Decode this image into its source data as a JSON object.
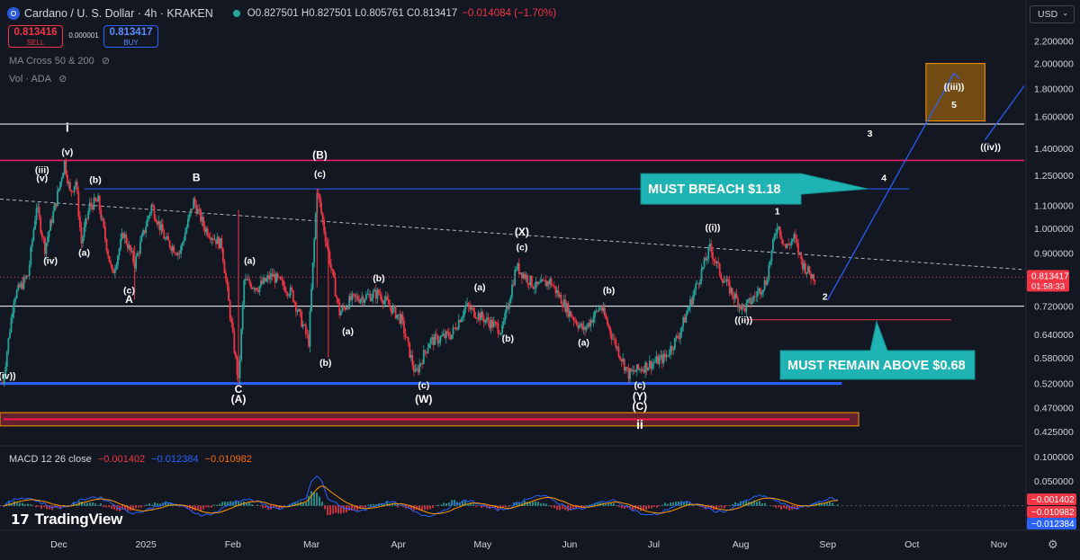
{
  "header": {
    "title": "Cardano / U. S. Dollar · 4h · KRAKEN",
    "ohlc": "O0.827501 H0.827501 L0.805761 C0.813417",
    "change": "−0.014084 (−1.70%)"
  },
  "trade": {
    "sell_price": "0.813416",
    "sell_label": "SELL",
    "spread": "0.000001",
    "buy_price": "0.813417",
    "buy_label": "BUY"
  },
  "indicators": {
    "ma": "MA Cross 50 & 200",
    "vol": "Vol · ADA"
  },
  "currency": "USD",
  "macd": {
    "label": "MACD 12 26 close",
    "macd": "−0.001402",
    "signal": "−0.012384",
    "hist": "−0.010982"
  },
  "brand": "TradingView",
  "colors": {
    "bg": "#131722",
    "up": "#26a69a",
    "down": "#f23645",
    "blue": "#2962ff",
    "magenta": "#e91e63",
    "teal": "#1fb3b3",
    "orange": "#ff9800"
  },
  "chart_data": {
    "type": "candlestick",
    "symbol": "ADAUSD",
    "interval": "4h",
    "exchange": "KRAKEN",
    "x_ticks": [
      "Dec",
      "2025",
      "Feb",
      "Mar",
      "Apr",
      "May",
      "Jun",
      "Jul",
      "Aug",
      "Sep",
      "Oct",
      "Nov"
    ],
    "y_ticks": [
      "2.200000",
      "2.000000",
      "1.800000",
      "1.600000",
      "1.400000",
      "1.250000",
      "1.100000",
      "1.000000",
      "0.900000",
      "0.720000",
      "0.640000",
      "0.580000",
      "0.520000",
      "0.470000",
      "0.425000"
    ],
    "y_scale": "log",
    "y_range": [
      0.4,
      2.35
    ],
    "x_range": [
      "2024-11-10",
      "2025-11-10"
    ],
    "price_path": [
      [
        "2024-11-11",
        0.52
      ],
      [
        "2024-11-15",
        0.75
      ],
      [
        "2024-11-20",
        0.82
      ],
      [
        "2024-11-23",
        1.1
      ],
      [
        "2024-11-26",
        0.92
      ],
      [
        "2024-11-30",
        1.12
      ],
      [
        "2024-12-03",
        1.32
      ],
      [
        "2024-12-05",
        1.16
      ],
      [
        "2024-12-07",
        1.22
      ],
      [
        "2024-12-09",
        0.94
      ],
      [
        "2024-12-12",
        1.1
      ],
      [
        "2024-12-15",
        1.12
      ],
      [
        "2024-12-20",
        0.82
      ],
      [
        "2024-12-24",
        0.98
      ],
      [
        "2024-12-28",
        0.86
      ],
      [
        "2025-01-03",
        1.1
      ],
      [
        "2025-01-08",
        0.95
      ],
      [
        "2025-01-13",
        0.9
      ],
      [
        "2025-01-18",
        1.12
      ],
      [
        "2025-01-22",
        1.0
      ],
      [
        "2025-01-28",
        0.93
      ],
      [
        "2025-02-03",
        0.52
      ],
      [
        "2025-02-05",
        0.8
      ],
      [
        "2025-02-10",
        0.78
      ],
      [
        "2025-02-15",
        0.82
      ],
      [
        "2025-02-22",
        0.76
      ],
      [
        "2025-02-28",
        0.62
      ],
      [
        "2025-03-03",
        1.18
      ],
      [
        "2025-03-07",
        0.9
      ],
      [
        "2025-03-11",
        0.7
      ],
      [
        "2025-03-15",
        0.74
      ],
      [
        "2025-03-25",
        0.76
      ],
      [
        "2025-04-02",
        0.68
      ],
      [
        "2025-04-07",
        0.54
      ],
      [
        "2025-04-12",
        0.62
      ],
      [
        "2025-04-20",
        0.64
      ],
      [
        "2025-04-25",
        0.72
      ],
      [
        "2025-05-02",
        0.68
      ],
      [
        "2025-05-08",
        0.65
      ],
      [
        "2025-05-13",
        0.85
      ],
      [
        "2025-05-20",
        0.78
      ],
      [
        "2025-05-25",
        0.8
      ],
      [
        "2025-06-01",
        0.7
      ],
      [
        "2025-06-06",
        0.65
      ],
      [
        "2025-06-12",
        0.72
      ],
      [
        "2025-06-17",
        0.62
      ],
      [
        "2025-06-22",
        0.54
      ],
      [
        "2025-06-28",
        0.56
      ],
      [
        "2025-07-05",
        0.58
      ],
      [
        "2025-07-10",
        0.64
      ],
      [
        "2025-07-16",
        0.78
      ],
      [
        "2025-07-21",
        0.92
      ],
      [
        "2025-07-25",
        0.82
      ],
      [
        "2025-07-29",
        0.76
      ],
      [
        "2025-08-02",
        0.71
      ],
      [
        "2025-08-06",
        0.75
      ],
      [
        "2025-08-10",
        0.8
      ],
      [
        "2025-08-14",
        1.02
      ],
      [
        "2025-08-17",
        0.92
      ],
      [
        "2025-08-20",
        0.96
      ],
      [
        "2025-08-23",
        0.86
      ],
      [
        "2025-08-26",
        0.82
      ],
      [
        "2025-08-28",
        0.8134
      ]
    ],
    "last_price": "0.813417",
    "countdown": "01:58:33",
    "levels": [
      {
        "price": 1.55,
        "color": "#ffffff",
        "from": "2024-11-10",
        "to": "2025-11-10"
      },
      {
        "price": 1.33,
        "color": "#e91e63",
        "from": "2024-11-10",
        "to": "2025-11-10"
      },
      {
        "price": 1.18,
        "color": "#2962ff",
        "from": "2024-12-10",
        "to": "2025-09-30"
      },
      {
        "price": 0.72,
        "color": "#ffffff",
        "from": "2024-11-10",
        "to": "2025-11-10"
      },
      {
        "price": 0.68,
        "color": "#f23645",
        "from": "2025-08-03",
        "to": "2025-10-15"
      },
      {
        "price": 0.52,
        "color": "#2962ff",
        "from": "2024-11-10",
        "to": "2025-09-06"
      }
    ],
    "trendline": {
      "from": [
        "2024-11-10",
        1.13
      ],
      "to": [
        "2025-11-10",
        0.84
      ],
      "style": "dashed"
    },
    "projection_box": {
      "x": [
        "2025-10-06",
        "2025-10-27"
      ],
      "y": [
        1.57,
        2.0
      ]
    },
    "bottom_zone": {
      "x": [
        "2024-11-10",
        "2025-09-12"
      ],
      "y": [
        0.435,
        0.46
      ]
    },
    "wave_labels": [
      {
        "text": "i",
        "x": "2024-12-04",
        "y": 1.5
      },
      {
        "text": "(v)",
        "x": "2024-12-04",
        "y": 1.36
      },
      {
        "text": "(iii)",
        "x": "2024-11-25",
        "y": 1.26
      },
      {
        "text": "(v)",
        "x": "2024-11-25",
        "y": 1.22
      },
      {
        "text": "(b)",
        "x": "2024-12-14",
        "y": 1.21
      },
      {
        "text": "B",
        "x": "2025-01-19",
        "y": 1.22
      },
      {
        "text": "(iv)",
        "x": "2024-11-28",
        "y": 0.86
      },
      {
        "text": "(a)",
        "x": "2024-12-10",
        "y": 0.89
      },
      {
        "text": "(c)",
        "x": "2024-12-26",
        "y": 0.76
      },
      {
        "text": "A",
        "x": "2024-12-26",
        "y": 0.73
      },
      {
        "text": "((iv))",
        "x": "2024-11-12",
        "y": 0.53
      },
      {
        "text": "C",
        "x": "2025-02-03",
        "y": 0.5
      },
      {
        "text": "(A)",
        "x": "2025-02-03",
        "y": 0.48
      },
      {
        "text": "(a)",
        "x": "2025-02-07",
        "y": 0.86
      },
      {
        "text": "(B)",
        "x": "2025-03-04",
        "y": 1.34
      },
      {
        "text": "(c)",
        "x": "2025-03-04",
        "y": 1.24
      },
      {
        "text": "(b)",
        "x": "2025-03-25",
        "y": 0.8
      },
      {
        "text": "(a)",
        "x": "2025-03-14",
        "y": 0.64
      },
      {
        "text": "(b)",
        "x": "2025-03-06",
        "y": 0.56
      },
      {
        "text": "(c)",
        "x": "2025-04-10",
        "y": 0.51
      },
      {
        "text": "(W)",
        "x": "2025-04-10",
        "y": 0.48
      },
      {
        "text": "(a)",
        "x": "2025-04-30",
        "y": 0.77
      },
      {
        "text": "(X)",
        "x": "2025-05-15",
        "y": 0.97
      },
      {
        "text": "(c)",
        "x": "2025-05-15",
        "y": 0.91
      },
      {
        "text": "(b)",
        "x": "2025-05-10",
        "y": 0.62
      },
      {
        "text": "(b)",
        "x": "2025-06-15",
        "y": 0.76
      },
      {
        "text": "(a)",
        "x": "2025-06-06",
        "y": 0.61
      },
      {
        "text": "(c)",
        "x": "2025-06-26",
        "y": 0.51
      },
      {
        "text": "(Y)",
        "x": "2025-06-26",
        "y": 0.485
      },
      {
        "text": "(C)",
        "x": "2025-06-26",
        "y": 0.465
      },
      {
        "text": "ii",
        "x": "2025-06-26",
        "y": 0.43
      },
      {
        "text": "((i))",
        "x": "2025-07-22",
        "y": 0.99
      },
      {
        "text": "((ii))",
        "x": "2025-08-02",
        "y": 0.67
      },
      {
        "text": "1",
        "x": "2025-08-14",
        "y": 1.06
      },
      {
        "text": "2",
        "x": "2025-08-31",
        "y": 0.74
      },
      {
        "text": "3",
        "x": "2025-09-16",
        "y": 1.47
      },
      {
        "text": "4",
        "x": "2025-09-21",
        "y": 1.22
      },
      {
        "text": "((iii))",
        "x": "2025-10-16",
        "y": 1.79
      },
      {
        "text": "5",
        "x": "2025-10-16",
        "y": 1.66
      },
      {
        "text": "((iv))",
        "x": "2025-10-29",
        "y": 1.39
      }
    ],
    "projection_paths": [
      [
        [
          "2025-09-01",
          0.74
        ],
        [
          "2025-10-16",
          1.92
        ]
      ],
      [
        [
          "2025-10-27",
          1.45
        ],
        [
          "2025-11-10",
          1.82
        ]
      ]
    ],
    "callouts": [
      {
        "text": "MUST BREACH $1.18",
        "x": "2025-09-10",
        "y": 1.18
      },
      {
        "text": "MUST REMAIN ABOVE $0.68",
        "x": "2025-09-12",
        "y": 0.68
      }
    ],
    "macd_series": {
      "y_ticks": [
        "0.100000",
        "0.050000"
      ],
      "y_range": [
        -0.045,
        0.12
      ]
    }
  }
}
